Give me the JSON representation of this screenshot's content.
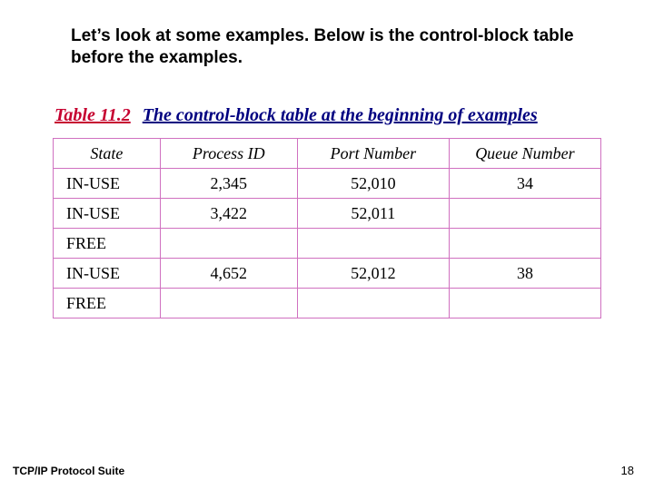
{
  "intro": "Let’s look at some examples.  Below is the control-block table before the examples.",
  "table_label": "Table 11.2",
  "table_caption": "The control-block table at the beginning of examples",
  "footer_left": "TCP/IP Protocol Suite",
  "footer_right": "18",
  "headers": {
    "state": "State",
    "pid": "Process ID",
    "port": "Port Number",
    "queue": "Queue Number"
  },
  "chart_data": {
    "type": "table",
    "title": "The control-block table at the beginning of examples",
    "columns": [
      "State",
      "Process ID",
      "Port Number",
      "Queue Number"
    ],
    "rows": [
      {
        "state": "IN-USE",
        "process_id": "2,345",
        "port_number": "52,010",
        "queue_number": "34"
      },
      {
        "state": "IN-USE",
        "process_id": "3,422",
        "port_number": "52,011",
        "queue_number": ""
      },
      {
        "state": "FREE",
        "process_id": "",
        "port_number": "",
        "queue_number": ""
      },
      {
        "state": "IN-USE",
        "process_id": "4,652",
        "port_number": "52,012",
        "queue_number": "38"
      },
      {
        "state": "FREE",
        "process_id": "",
        "port_number": "",
        "queue_number": ""
      }
    ]
  }
}
